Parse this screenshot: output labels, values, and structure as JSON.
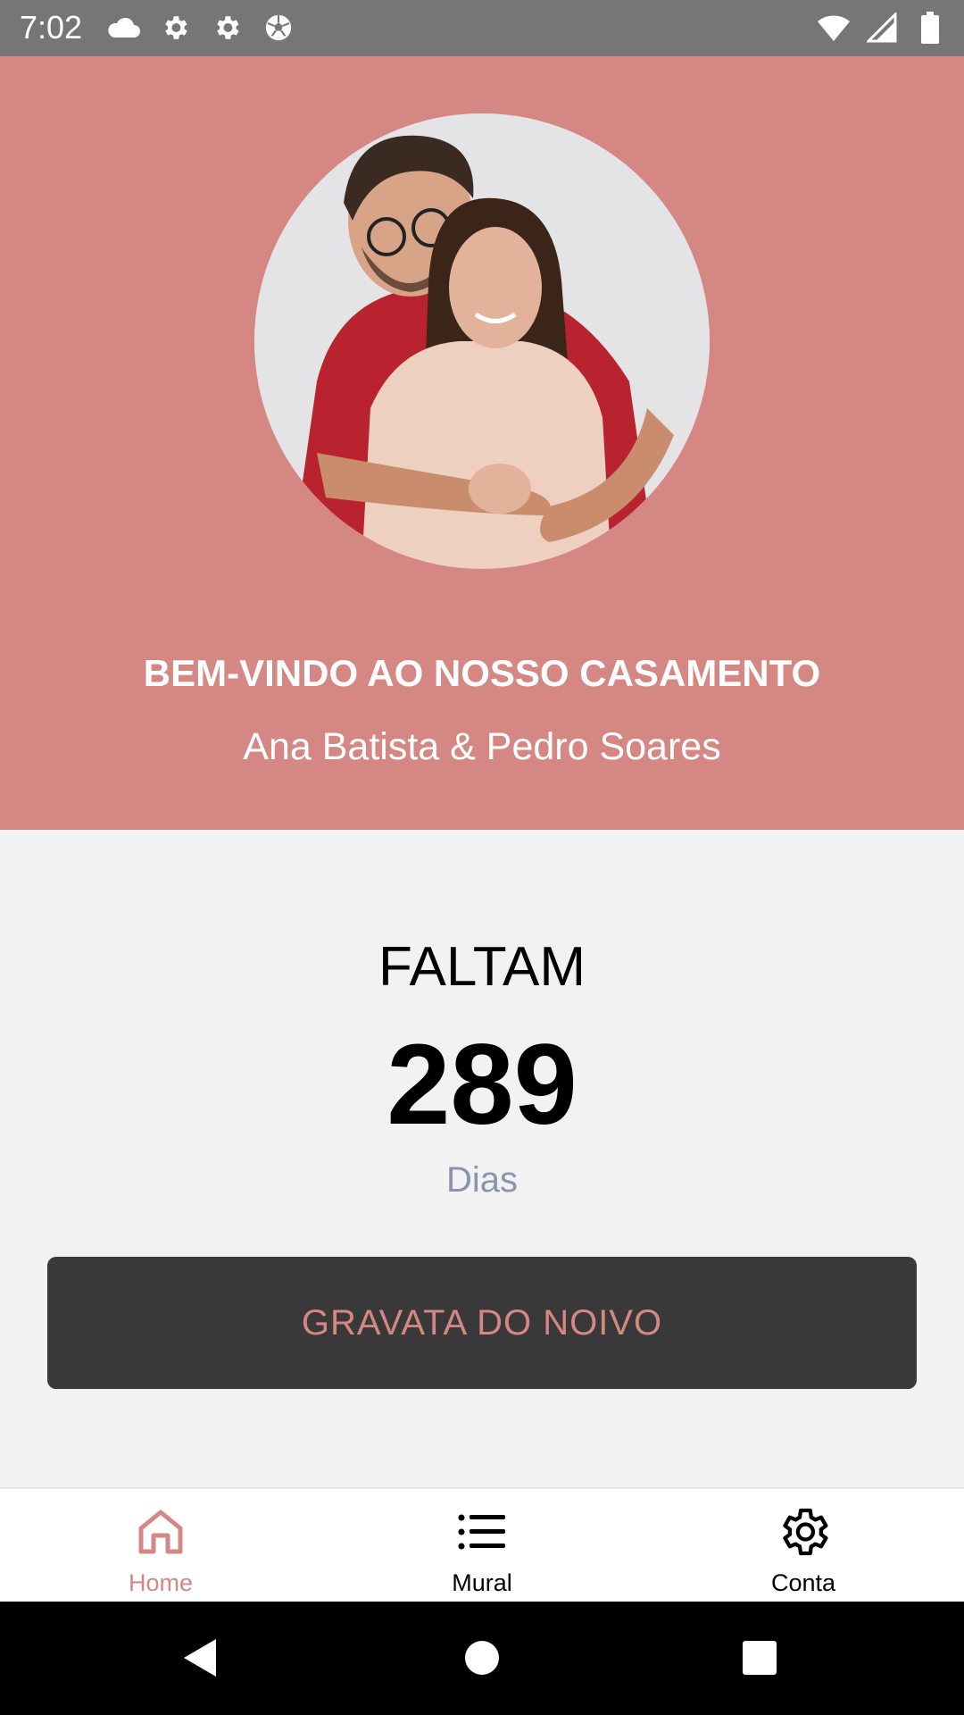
{
  "status_bar": {
    "time": "7:02",
    "left_icons": [
      "cloud-icon",
      "gear-icon",
      "gear-icon",
      "soccer-ball-icon"
    ],
    "right_icons": [
      "wifi-icon",
      "signal-icon",
      "battery-icon"
    ]
  },
  "header": {
    "background_color": "#d58784",
    "welcome_title": "BEM-VINDO AO NOSSO CASAMENTO",
    "couple_names": "Ana Batista & Pedro Soares"
  },
  "countdown": {
    "label": "FALTAM",
    "value": "289",
    "unit": "Dias"
  },
  "actions": {
    "tie_button_label": "GRAVATA DO NOIVO"
  },
  "bottom_nav": {
    "items": [
      {
        "label": "Home",
        "icon": "home-icon",
        "active": true
      },
      {
        "label": "Mural",
        "icon": "list-icon",
        "active": false
      },
      {
        "label": "Conta",
        "icon": "gear-icon",
        "active": false
      }
    ]
  },
  "colors": {
    "accent": "#d58784",
    "button_bg": "#393939",
    "unit_text": "#8c93b0"
  }
}
